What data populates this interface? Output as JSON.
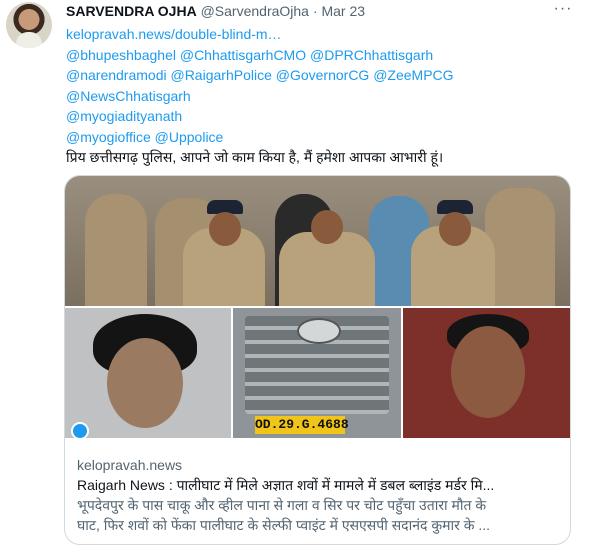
{
  "tweet": {
    "author_name": "SARVENDRA OJHA",
    "author_handle": "@SarvendraOjha",
    "separator": "·",
    "date": "Mar 23",
    "more_label": "···",
    "lines": [
      {
        "text": "kelopravah.news/double-blind-m…",
        "kind": "link"
      },
      {
        "text": "@bhupeshbaghel @ChhattisgarhCMO @DPRChhattisgarh",
        "kind": "link"
      },
      {
        "text": "@narendramodi @RaigarhPolice @GovernorCG @ZeeMPCG",
        "kind": "link"
      },
      {
        "text": "@NewsChhatisgarh",
        "kind": "link"
      },
      {
        "text": "@myogiadityanath",
        "kind": "link"
      },
      {
        "text": "@myogioffice @Uppolice",
        "kind": "link"
      },
      {
        "text": "प्रिय छत्तीसगढ़ पुलिस, आपने जो काम किया है, मैं हमेशा आपका आभारी हूं।",
        "kind": "text"
      }
    ]
  },
  "card": {
    "domain": "kelopravah.news",
    "title": "Raigarh News : पालीघाट में मिले अज्ञात शवों में मामले में डबल ब्लाइंड मर्डर मि...",
    "description_lines": [
      "भूपदेवपुर के पास चाकू और व्हील पाना से गला व सिर पर चोट पहुँचा उतारा मौत के",
      "घाट, फिर शवों को फेंका पालीघाट के सेल्फी प्वाइंट में एसएसपी सदानंद कुमार के ..."
    ],
    "plate_text": "OD.29.G.4688"
  },
  "colors": {
    "link": "#1d9bf0",
    "text": "#0f1419",
    "secondary": "#536471",
    "border": "#cfd9de"
  }
}
